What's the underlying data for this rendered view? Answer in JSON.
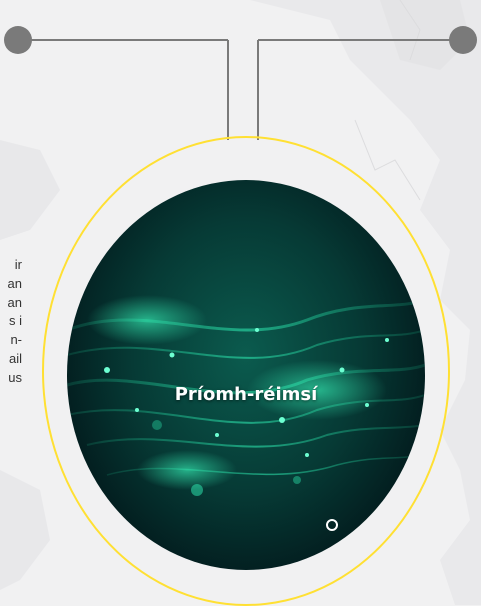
{
  "side_text": {
    "lines": [
      "ir",
      "an",
      "an",
      "s i",
      "n-",
      "ail",
      "us"
    ]
  },
  "focus_disc": {
    "label": "Príomh-réimsí"
  },
  "colors": {
    "background": "#f1f1f2",
    "map_land": "#e8e8ea",
    "connector_line": "#7a7a7a",
    "connector_dot": "#7a7a7a",
    "ring": "#ffe033"
  }
}
